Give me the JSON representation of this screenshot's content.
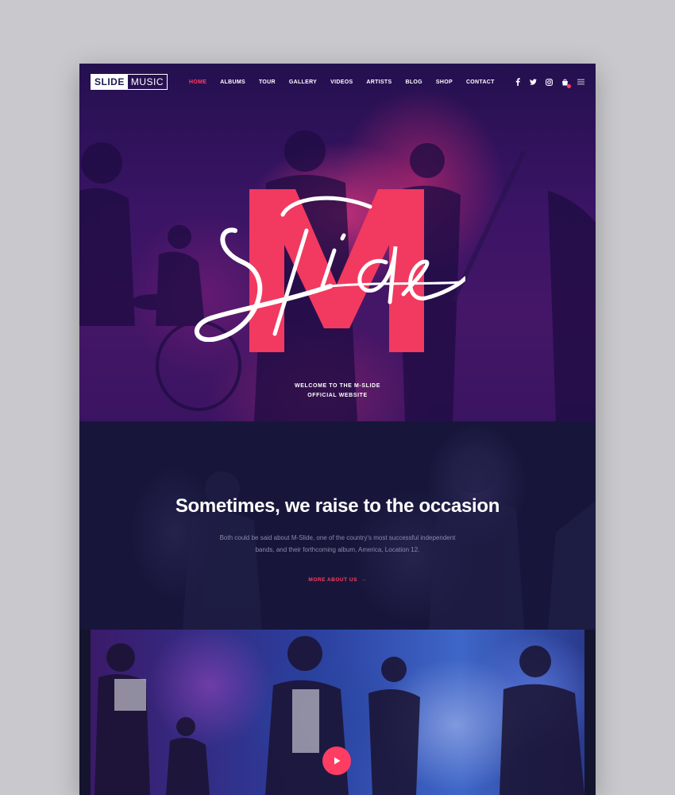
{
  "logo": {
    "part_a": "SLIDE",
    "part_b": "MUSIC"
  },
  "nav": {
    "items": [
      "HOME",
      "ALBUMS",
      "TOUR",
      "GALLERY",
      "VIDEOS",
      "ARTISTS",
      "BLOG",
      "SHOP",
      "CONTACT"
    ],
    "active": "HOME"
  },
  "header_icons": [
    "facebook-icon",
    "twitter-icon",
    "instagram-icon",
    "cart-icon",
    "menu-icon"
  ],
  "hero": {
    "big_letter": "M",
    "script_word": "Slide",
    "welcome_line1": "WELCOME TO THE M-SLIDE",
    "welcome_line2": "OFFICIAL WEBSITE"
  },
  "about": {
    "title": "Sometimes, we raise to the occasion",
    "text_line1": "Both could be said about M-Slide, one of the country's most successful independent",
    "text_line2": "bands, and their forthcoming album, America, Location 12.",
    "link_label": "MORE ABOUT US"
  },
  "colors": {
    "accent": "#ff3d63",
    "hero_overlay": "#3a1465",
    "about_bg": "#17163a",
    "page_bg": "#c9c9cd"
  }
}
